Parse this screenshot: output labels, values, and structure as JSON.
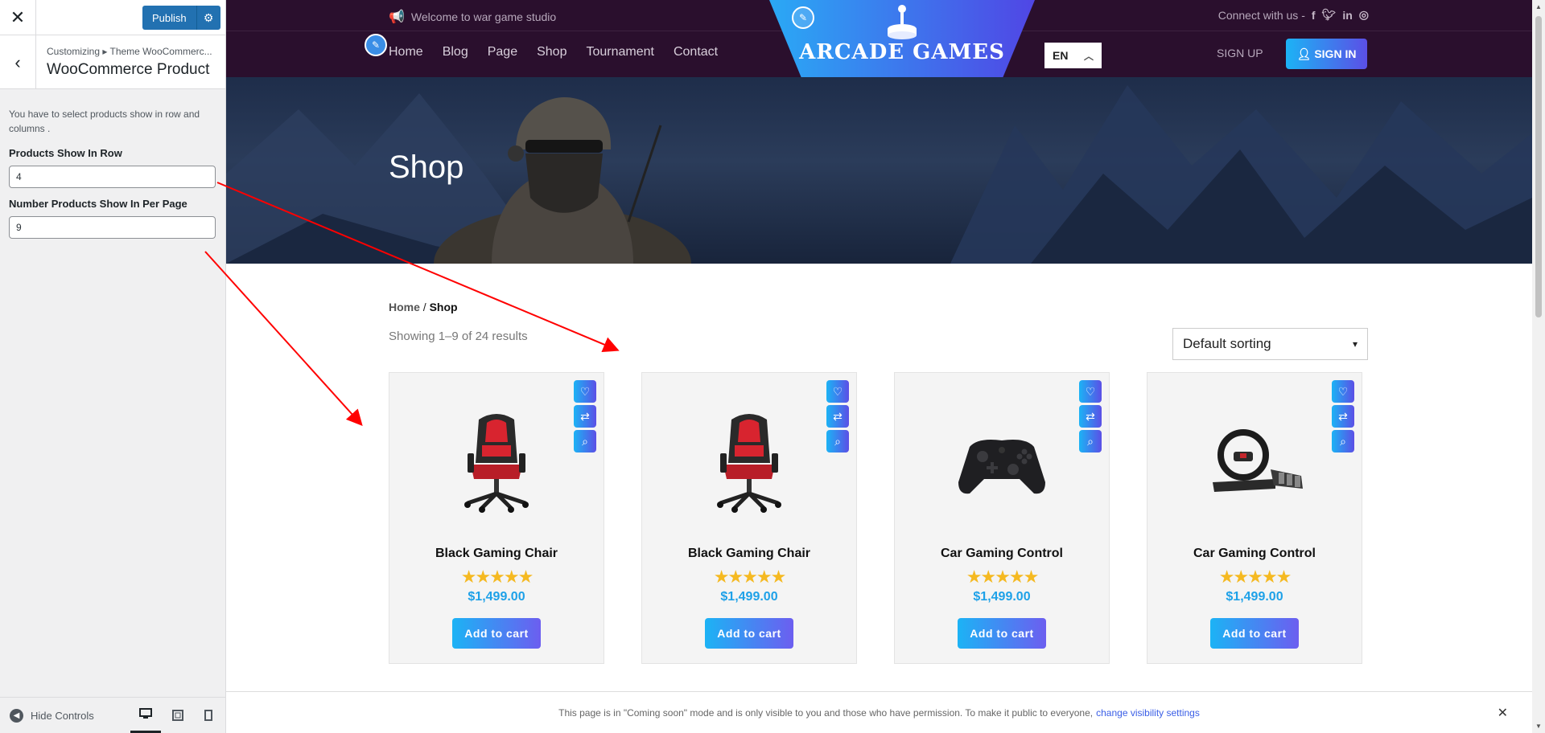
{
  "customizer": {
    "close_icon": "close-icon",
    "publish_label": "Publish",
    "breadcrumb": "Customizing ▸ Theme WooCommerc...",
    "section_title": "WooCommerce Product",
    "description": "You have to select products show in row and columns .",
    "field_row_label": "Products Show In Row",
    "field_row_value": "4",
    "field_page_label": "Number Products Show In Per Page",
    "field_page_value": "9",
    "hide_controls": "Hide Controls"
  },
  "header": {
    "welcome": "Welcome to war game studio",
    "connect": "Connect with us -",
    "nav": [
      "Home",
      "Blog",
      "Page",
      "Shop",
      "Tournament",
      "Contact"
    ],
    "logo_text": "ARCADE GAMES",
    "lang": "EN",
    "signup": "SIGN UP",
    "signin": "SIGN IN"
  },
  "hero": {
    "title": "Shop"
  },
  "shop": {
    "breadcrumb_home": "Home",
    "breadcrumb_sep": " / ",
    "breadcrumb_current": "Shop",
    "results": "Showing 1–9 of 24 results",
    "sort": "Default sorting",
    "products": [
      {
        "name": "Black Gaming Chair",
        "rating": 5,
        "price": "$1,499.00",
        "cta": "Add to cart",
        "image": "chair-image"
      },
      {
        "name": "Black Gaming Chair",
        "rating": 5,
        "price": "$1,499.00",
        "cta": "Add to cart",
        "image": "chair-image"
      },
      {
        "name": "Car Gaming Control",
        "rating": 5,
        "price": "$1,499.00",
        "cta": "Add to cart",
        "image": "gamepad-image"
      },
      {
        "name": "Car Gaming Control",
        "rating": 5,
        "price": "$1,499.00",
        "cta": "Add to cart",
        "image": "steering-wheel-image"
      }
    ]
  },
  "notice": {
    "text": "This page is in \"Coming soon\" mode and is only visible to you and those who have permission. To make it public to everyone,",
    "link": "change visibility settings"
  },
  "colors": {
    "accent_start": "#1cb3f5",
    "accent_end": "#5b4fe6",
    "header_bg": "#2a0f2d",
    "wp_blue": "#2271b1",
    "annotation": "#ff0000"
  }
}
